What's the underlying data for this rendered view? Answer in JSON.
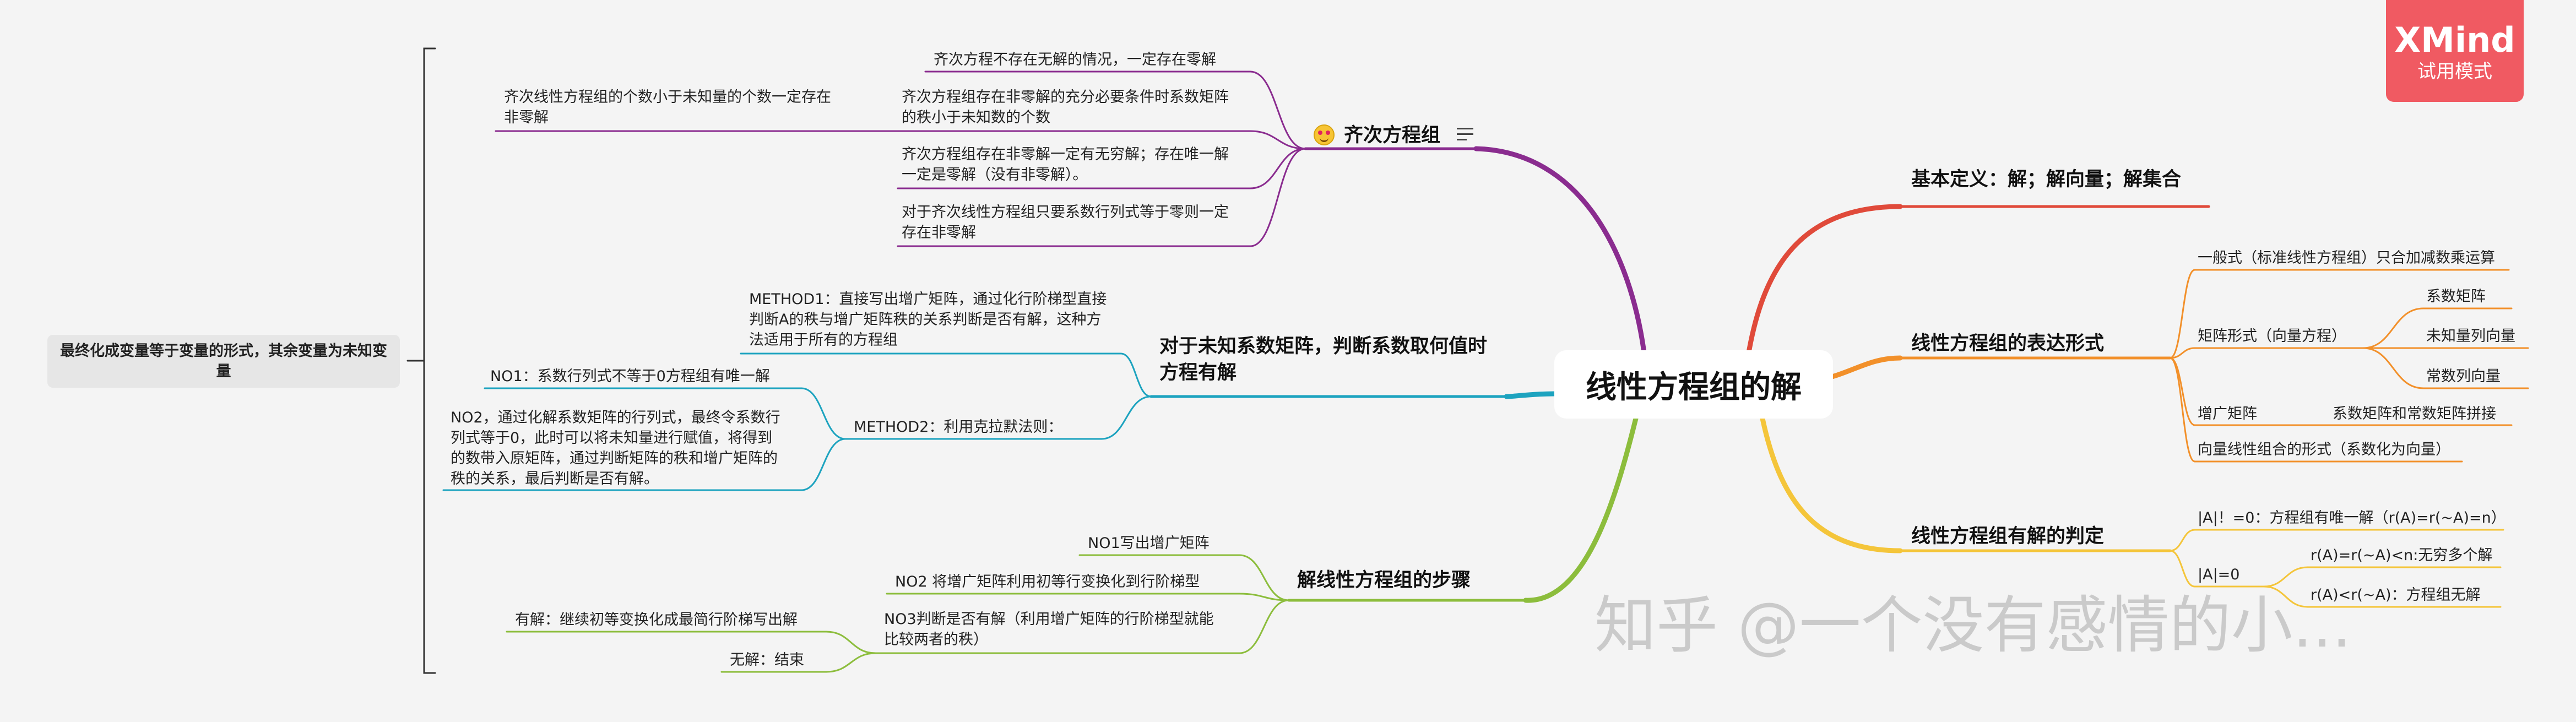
{
  "app": {
    "name": "XMind",
    "mode": "试用模式"
  },
  "watermark": "知乎 @一个没有感情的小...",
  "root": "线性方程组的解",
  "summary": "最终化成变量等于变量的形式，其余变量为未知变量",
  "right": {
    "basic": "基本定义：解；解向量；解集合",
    "forms": {
      "label": "线性方程组的表达形式",
      "general": "一般式（标准线性方程组）只合加减数乘运算",
      "matrix": {
        "label": "矩阵形式（向量方程）",
        "items": [
          "系数矩阵",
          "未知量列向量",
          "常数列向量"
        ]
      },
      "augmented": {
        "label": "增广矩阵",
        "desc": "系数矩阵和常数矩阵拼接"
      },
      "vector": "向量线性组合的形式（系数化为向量）"
    },
    "judge": {
      "label": "线性方程组有解的判定",
      "item1": "|A|！=0：方程组有唯一解（r(A)=r(~A)=n）",
      "item2": {
        "label": "|A|=0",
        "sub1": "r(A)=r(~A)<n:无穷多个解",
        "sub2": "r(A)<r(~A)：方程组无解"
      }
    }
  },
  "left": {
    "homogeneous": {
      "label": "齐次方程组",
      "items": [
        "齐次方程不存在无解的情况，一定存在零解",
        "齐次方程组存在非零解的充分必要条件时系数矩阵的秩小于未知数的个数",
        "齐次方程组存在非零解一定有无穷解；存在唯一解一定是零解（没有非零解）。",
        "对于齐次线性方程组只要系数行列式等于零则一定存在非零解"
      ],
      "sub": "齐次线性方程组的个数小于未知量的个数一定存在非零解"
    },
    "unknown": {
      "label": "对于未知系数矩阵，判断系数取何值时方程有解",
      "method1": "METHOD1：直接写出增广矩阵，通过化行阶梯型直接判断A的秩与增广矩阵秩的关系判断是否有解，这种方法适用于所有的方程组",
      "method2": {
        "label": "METHOD2：利用克拉默法则：",
        "no1": "NO1：系数行列式不等于0方程组有唯一解",
        "no2": "NO2，通过化解系数矩阵的行列式，最终令系数行列式等于0，此时可以将未知量进行赋值，将得到的数带入原矩阵，通过判断矩阵的秩和增广矩阵的秩的关系，最后判断是否有解。"
      }
    },
    "steps": {
      "label": "解线性方程组的步骤",
      "no1": "NO1写出增广矩阵",
      "no2": "NO2 将增广矩阵利用初等行变换化到行阶梯型",
      "no3": {
        "label": "NO3判断是否有解（利用增广矩阵的行阶梯型就能比较两者的秩）",
        "yes": "有解：继续初等变换化成最简行阶梯写出解",
        "no": "无解：结束"
      }
    }
  },
  "colors": {
    "red": "#e04a3a",
    "orange": "#f2902a",
    "yellow": "#f4c53a",
    "purple": "#8a2c8f",
    "teal": "#1da3bf",
    "green": "#8cbd3c",
    "badge": "#f05a62"
  },
  "icons": [
    "smiling-face-icon",
    "notes-icon"
  ]
}
